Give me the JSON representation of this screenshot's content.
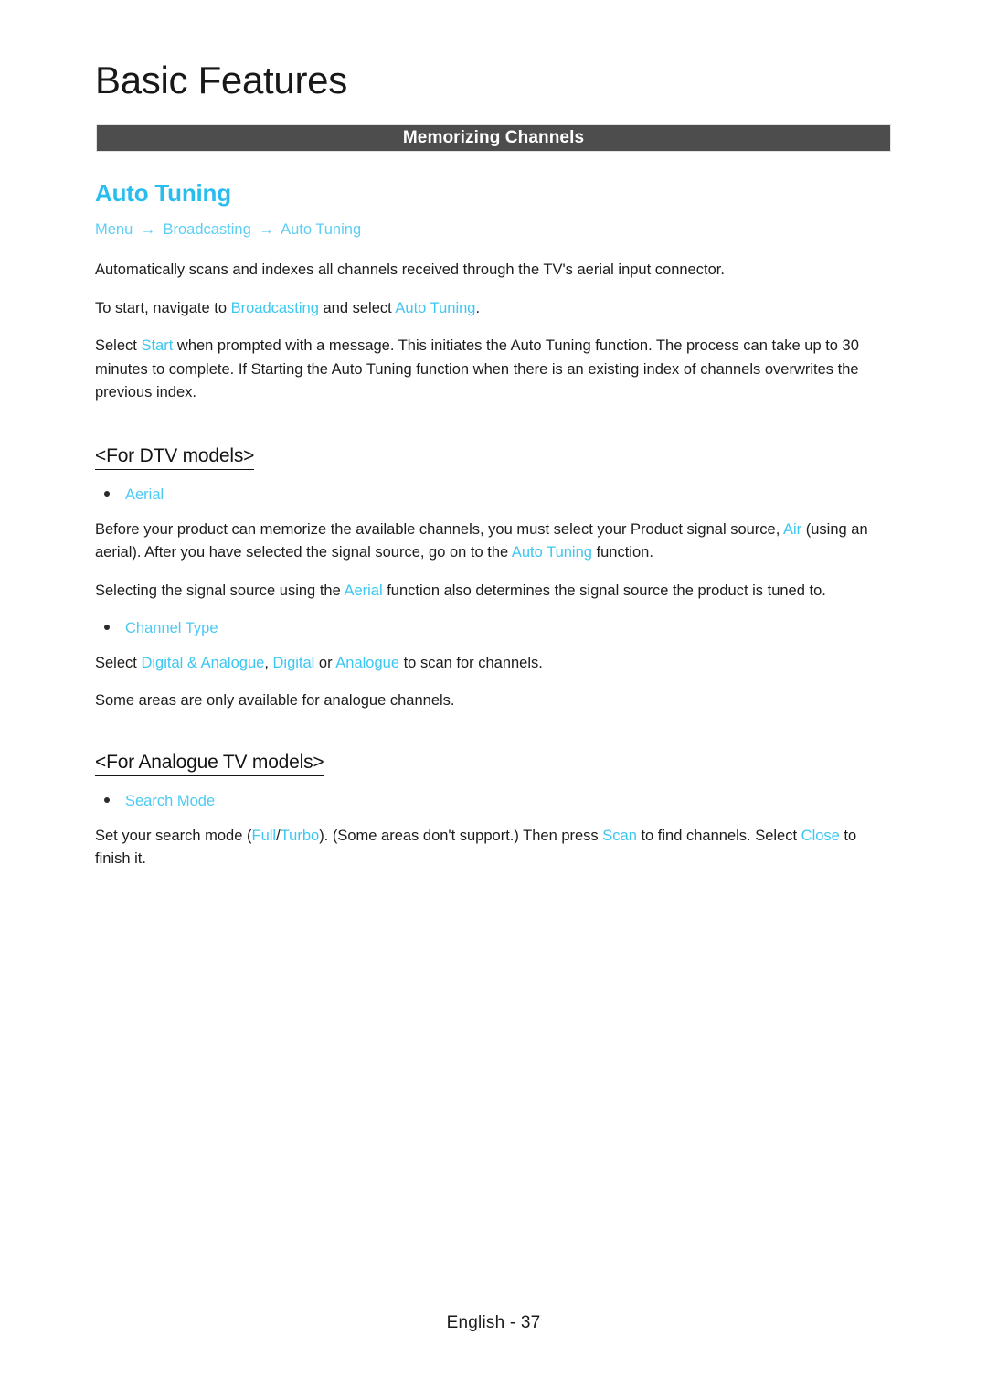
{
  "document": {
    "chapter_title": "Basic Features",
    "section_banner": "Memorizing Channels",
    "footer": "English - 37",
    "colors": {
      "accent_heading": "#29bdef",
      "accent_inline": "#3cc6f2",
      "banner_background": "#4d4d4d",
      "banner_text": "#ffffff",
      "body_text": "#1c1c1c"
    }
  },
  "topic": {
    "heading": "Auto Tuning",
    "breadcrumb": {
      "items": [
        "Menu",
        "Broadcasting",
        "Auto Tuning"
      ],
      "separator": "→"
    },
    "paragraphs": {
      "intro": "Automatically scans and indexes all channels received through the TV's aerial input connector.",
      "navigate_prefix": "To start, navigate to ",
      "navigate_link1": "Broadcasting",
      "navigate_middle": " and select ",
      "navigate_link2": "Auto Tuning",
      "navigate_suffix": ".",
      "start_prefix": "Select ",
      "start_link": "Start",
      "start_suffix": " when prompted with a message. This initiates the Auto Tuning function. The process can take up to 30 minutes to complete. If Starting the Auto Tuning function when there is an existing index of channels overwrites the previous index."
    }
  },
  "dtv_section": {
    "heading": "<For DTV models>",
    "bullets": [
      {
        "label": "Aerial"
      },
      {
        "label": "Channel Type"
      }
    ],
    "aerial_body": {
      "part1": "Before your product can memorize the available channels, you must select your Product signal source, ",
      "link1": "Air",
      "part2": " (using an aerial). After you have selected the signal source, go on to the ",
      "link2": "Auto Tuning",
      "part3": " function."
    },
    "aerial_note": {
      "part1": "Selecting the signal source using the ",
      "link1": "Aerial",
      "part2": " function also determines the signal source the product is tuned to."
    },
    "channel_type_body": {
      "part1": "Select ",
      "link1": "Digital & Analogue",
      "part2": ", ",
      "link2": "Digital",
      "part3": " or ",
      "link3": "Analogue",
      "part4": " to scan for channels."
    },
    "channel_type_note": "Some areas are only available for analogue channels."
  },
  "analogue_section": {
    "heading": "<For Analogue TV models>",
    "bullets": [
      {
        "label": "Search Mode"
      }
    ],
    "search_mode_body": {
      "part1": "Set your search mode (",
      "link1": "Full",
      "part2": "/",
      "link2": "Turbo",
      "part3": "). (Some areas don't support.) Then press ",
      "link3": "Scan",
      "part4": " to find channels. Select ",
      "link4": "Close",
      "part5": " to finish it."
    }
  }
}
